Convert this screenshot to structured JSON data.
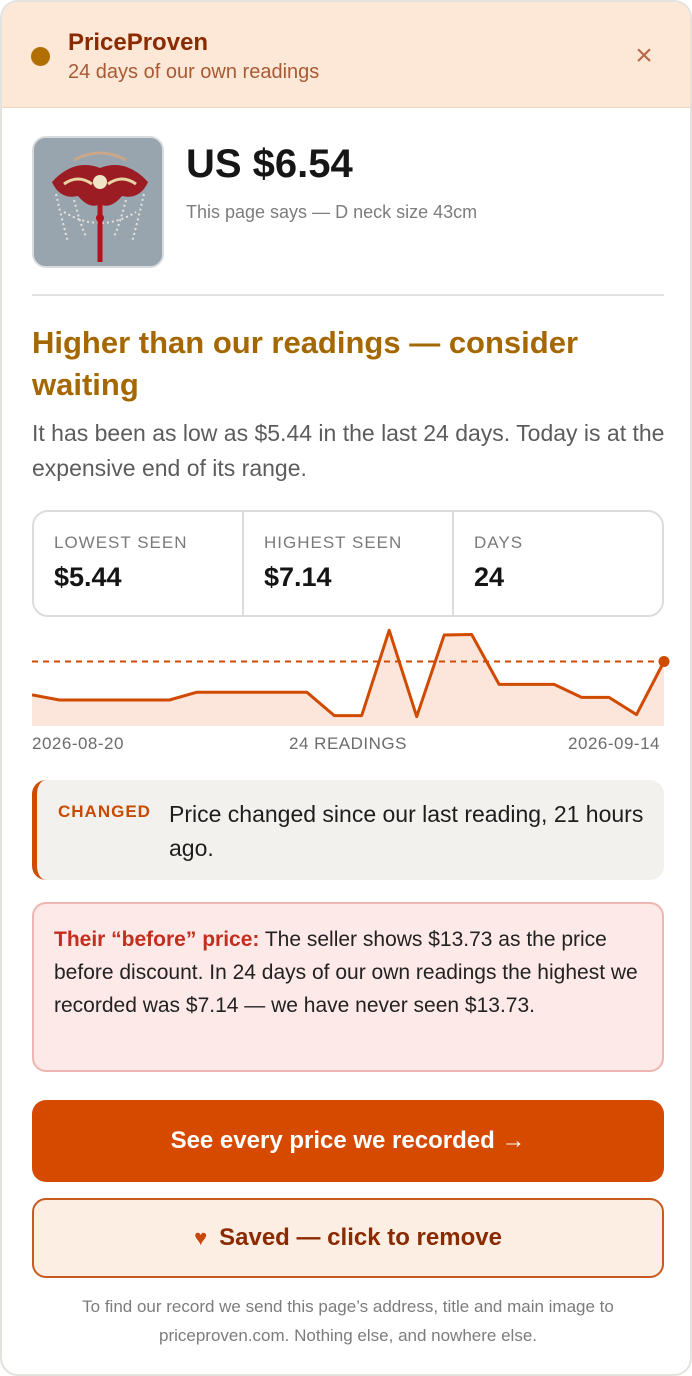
{
  "header": {
    "title": "PriceProven",
    "subtitle": "24 days of our own readings",
    "close_icon": "close-icon"
  },
  "product": {
    "price": "US $6.54",
    "page_says": "This page says — D neck size 43cm",
    "image_icon": "product-image"
  },
  "verdict": {
    "headline": "Higher than our readings — consider waiting",
    "text": "It has been as low as $5.44 in the last 24 days. Today is at the expensive end of its range."
  },
  "stats": [
    {
      "label": "LOWEST SEEN",
      "value": "$5.44"
    },
    {
      "label": "HIGHEST SEEN",
      "value": "$7.14"
    },
    {
      "label": "DAYS",
      "value": "24"
    }
  ],
  "chart_data": {
    "type": "line",
    "x_start": "2026-08-20",
    "x_end": "2026-09-14",
    "center_label": "24 READINGS",
    "values": [
      5.9,
      5.8,
      5.8,
      5.8,
      5.8,
      5.8,
      5.95,
      5.95,
      5.95,
      5.95,
      5.95,
      5.5,
      5.5,
      7.14,
      5.48,
      7.05,
      7.06,
      6.1,
      6.1,
      6.1,
      5.85,
      5.85,
      5.52,
      6.54
    ],
    "reference_value": 6.54,
    "ylim": [
      5.3,
      7.3
    ],
    "colors": {
      "line": "#d04a00",
      "fill": "#fce6dc",
      "reference": "#d04a00"
    }
  },
  "changed": {
    "badge": "CHANGED",
    "message": "Price changed since our last reading, 21 hours ago."
  },
  "before_price": {
    "lead": "Their “before” price:",
    "text": " The seller shows $13.73 as the price before discount. In 24 days of our own readings the highest we recorded was $7.14 — we have never seen $13.73."
  },
  "actions": {
    "primary_label": "See every price we recorded →",
    "saved_icon": "heart-icon",
    "saved_glyph": "♥",
    "saved_label": "Saved — click to remove"
  },
  "footer": {
    "note": "To find our record we send this page’s address, title and main image to priceproven.com. Nothing else, and nowhere else."
  }
}
